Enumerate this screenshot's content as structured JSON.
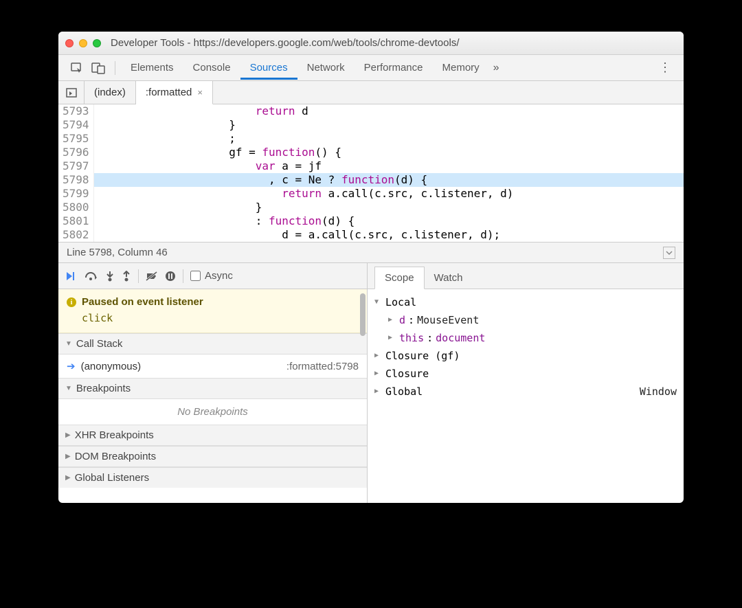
{
  "window": {
    "title": "Developer Tools - https://developers.google.com/web/tools/chrome-devtools/"
  },
  "tabs": {
    "elements": "Elements",
    "console": "Console",
    "sources": "Sources",
    "network": "Network",
    "performance": "Performance",
    "memory": "Memory"
  },
  "file_tabs": {
    "index": "(index)",
    "formatted": ":formatted"
  },
  "code": {
    "lines": [
      {
        "n": "5793",
        "ind": "                        ",
        "tok": [
          [
            "k",
            "return"
          ],
          [
            "p",
            " d"
          ]
        ]
      },
      {
        "n": "5794",
        "ind": "                    ",
        "tok": [
          [
            "p",
            "}"
          ]
        ]
      },
      {
        "n": "5795",
        "ind": "                    ",
        "tok": [
          [
            "p",
            ";"
          ]
        ]
      },
      {
        "n": "5796",
        "ind": "                    ",
        "tok": [
          [
            "p",
            "gf = "
          ],
          [
            "k",
            "function"
          ],
          [
            "p",
            "() {"
          ]
        ]
      },
      {
        "n": "5797",
        "ind": "                        ",
        "tok": [
          [
            "k",
            "var"
          ],
          [
            "p",
            " a = jf"
          ]
        ]
      },
      {
        "n": "5798",
        "ind": "                          ",
        "hl": true,
        "tok": [
          [
            "p",
            ", c = Ne ? "
          ],
          [
            "k",
            "function"
          ],
          [
            "p",
            "(d) {"
          ]
        ]
      },
      {
        "n": "5799",
        "ind": "                            ",
        "tok": [
          [
            "k",
            "return"
          ],
          [
            "p",
            " a.call(c.src, c.listener, d)"
          ]
        ]
      },
      {
        "n": "5800",
        "ind": "                        ",
        "tok": [
          [
            "p",
            "}"
          ]
        ]
      },
      {
        "n": "5801",
        "ind": "                        ",
        "tok": [
          [
            "p",
            ": "
          ],
          [
            "k",
            "function"
          ],
          [
            "p",
            "(d) {"
          ]
        ]
      },
      {
        "n": "5802",
        "ind": "                            ",
        "tok": [
          [
            "p",
            "d = a.call(c.src, c.listener, d);"
          ]
        ]
      }
    ]
  },
  "status": {
    "text": "Line 5798, Column 46"
  },
  "async": "Async",
  "paused": {
    "title": "Paused on event listener",
    "event": "click"
  },
  "callstack": {
    "title": "Call Stack",
    "frame": "(anonymous)",
    "loc": ":formatted:5798"
  },
  "breakpoints": {
    "title": "Breakpoints",
    "empty": "No Breakpoints"
  },
  "xhrbp": "XHR Breakpoints",
  "dombp": "DOM Breakpoints",
  "glis": "Global Listeners",
  "scope_tabs": {
    "scope": "Scope",
    "watch": "Watch"
  },
  "scope": {
    "local": "Local",
    "d_key": "d",
    "d_val": "MouseEvent",
    "this_key": "this",
    "this_val": "document",
    "closure_gf": "Closure (gf)",
    "closure": "Closure",
    "global": "Global",
    "global_val": "Window"
  }
}
